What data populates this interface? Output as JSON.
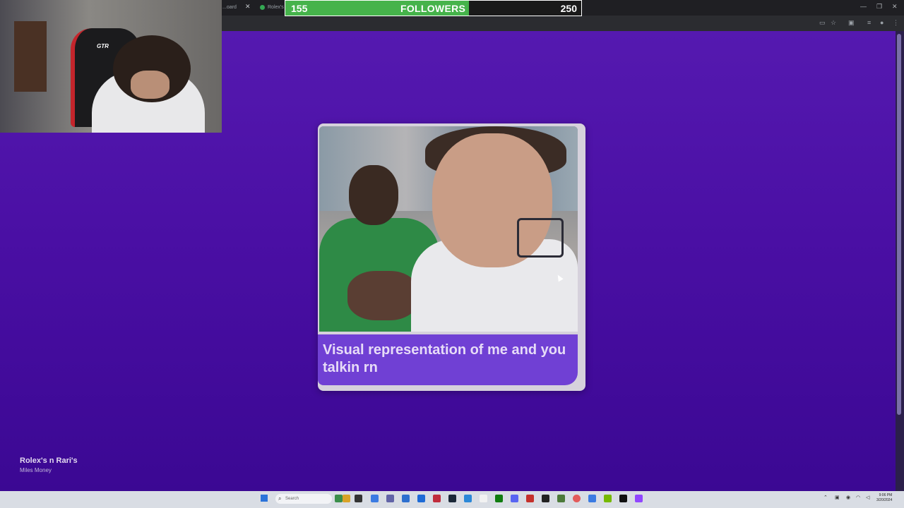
{
  "browser": {
    "tabs": [
      {
        "label": "...oard",
        "icon": "tab-icon"
      },
      {
        "label": "Rolex's n...",
        "icon": "spotify-icon"
      }
    ]
  },
  "follower_goal": {
    "current": "155",
    "label": "FOLLOWERS",
    "target": "250",
    "progress_fraction": 0.62
  },
  "webcam": {
    "chair_brand": "GTR"
  },
  "card": {
    "caption": "Visual representation of me and you talkin rn"
  },
  "now_playing": {
    "title": "Rolex's n Rari's",
    "artist": "Miles Money"
  },
  "taskbar": {
    "search_placeholder": "Search",
    "clock_time": "9:06 PM",
    "clock_date": "3/20/2024"
  },
  "colors": {
    "page_bg": "#4a0fa4",
    "caption_bg": "#7040d4",
    "progress_fill": "#46b34b"
  }
}
